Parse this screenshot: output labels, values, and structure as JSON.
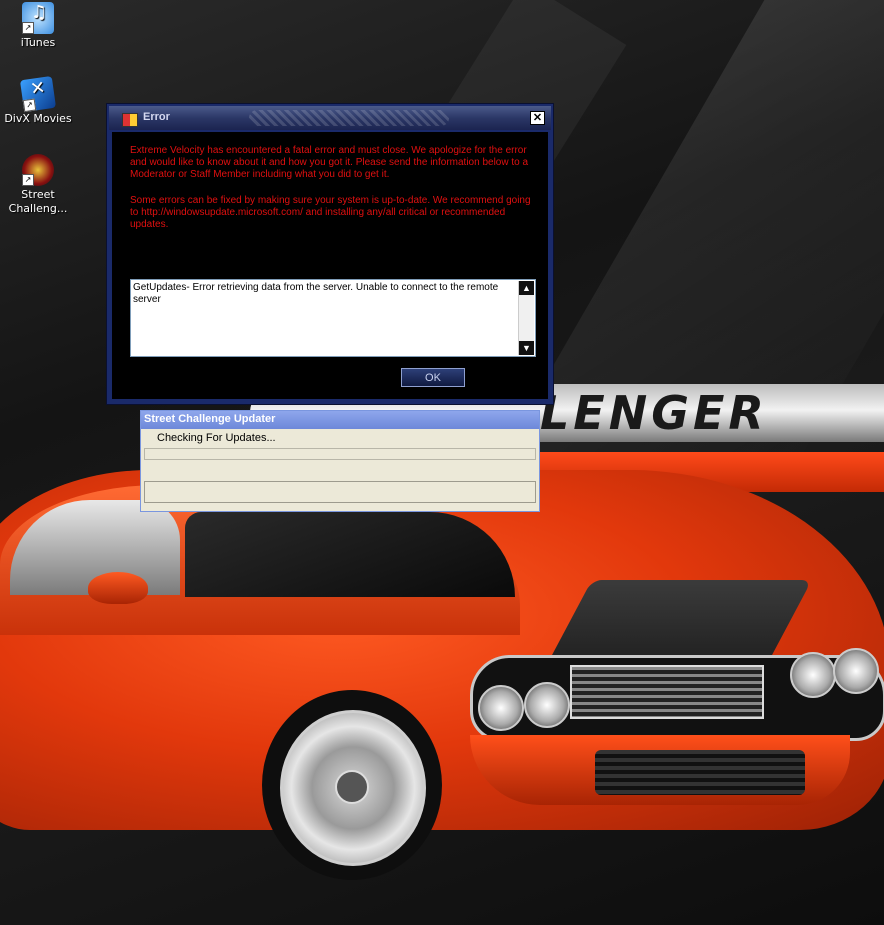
{
  "desktop": {
    "icons": [
      {
        "label": "iTunes",
        "icon": "itunes-icon"
      },
      {
        "label": "DivX Movies",
        "icon": "divx-icon"
      },
      {
        "label": "Street Challeng...",
        "icon": "street-challenge-icon"
      }
    ],
    "wallpaper_logo_text": "LENGER"
  },
  "error_dialog": {
    "title": "Error",
    "message_p1": "Extreme Velocity has encountered a fatal error and must close. We apologize for the error and would like to know about it and how you got it. Please send the information below to a Moderator or Staff Member including what you did to get it.",
    "message_p2": "Some errors can be fixed by making sure your system is up-to-date. We recommend going to http://windowsupdate.microsoft.com/ and installing any/all critical or recommended updates.",
    "details_text": "GetUpdates- Error retrieving data from the server. Unable to connect to the remote server",
    "ok_label": "OK",
    "close_symbol": "✕",
    "colors": {
      "message": "#e01010",
      "background": "#000000",
      "frame": "#1a2a6a"
    }
  },
  "updater_dialog": {
    "title": "Street Challenge Updater",
    "status": "Checking For Updates...",
    "progress": 0
  }
}
